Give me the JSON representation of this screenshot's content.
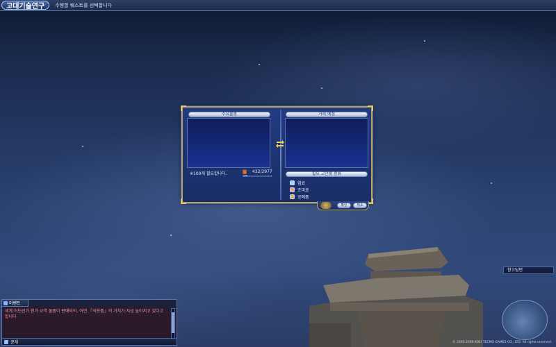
{
  "topbar": {
    "badge": "고대기술연구",
    "hint": "수행할 퀘스트를 선택합니다"
  },
  "exchange": {
    "left_header": "소유물품",
    "right_header": "거래 예정",
    "skill_header": "필요 고안품 종류",
    "need_text": "※100개 필요합니다.",
    "amount": "432/2977",
    "progress_fraction": 0.15,
    "skills": [
      {
        "label": "염료",
        "icon": "dye-icon"
      },
      {
        "label": "조미료",
        "icon": "seasoning-icon"
      },
      {
        "label": "공예품",
        "icon": "craft-icon"
      }
    ],
    "buttons": {
      "confirm": "확인",
      "cancel": "취소"
    }
  },
  "side": {
    "label": "창고담변"
  },
  "chat": {
    "tab": "이벤트",
    "message": "세계 어딘선가 뭔가 교역 물품이 판매되어. 어떤 『석용품』의 가치가 지금 높아지고 있다고 합니다",
    "mode": "공개"
  },
  "copyright": "© 2005-2009 KOEI TECMO GAMES CO., LTD. All rights reserved."
}
